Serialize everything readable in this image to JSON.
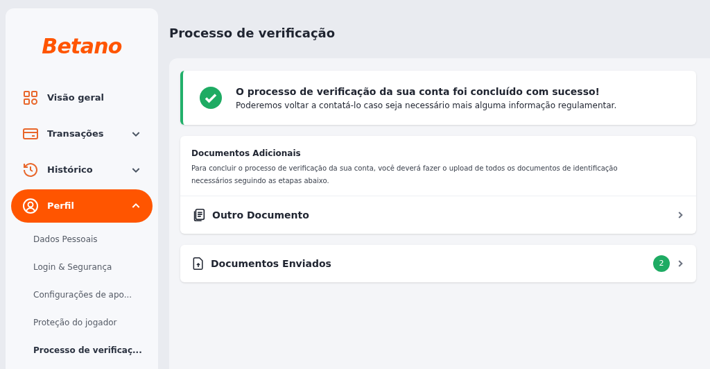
{
  "sidebar": {
    "logo": "Betano",
    "items": [
      {
        "label": "Visão geral",
        "kind": "grid",
        "selected": false
      },
      {
        "label": "Transações",
        "kind": "card",
        "selected": false,
        "expanded": false
      },
      {
        "label": "Histórico",
        "kind": "history",
        "selected": false,
        "expanded": false
      },
      {
        "label": "Perfil",
        "kind": "user",
        "selected": true,
        "expanded": true,
        "children": [
          {
            "label": "Dados Pessoais",
            "selected": false
          },
          {
            "label": "Login & Segurança",
            "selected": false
          },
          {
            "label": "Configurações de apo...",
            "selected": false
          },
          {
            "label": "Proteção do jogador",
            "selected": false
          },
          {
            "label": "Processo de verificaç...",
            "selected": true
          }
        ]
      }
    ]
  },
  "page": {
    "title": "Processo de verificação",
    "alert": {
      "title": "O processo de verificação da sua conta foi concluído com sucesso!",
      "text": "Poderemos voltar a contatá-lo caso seja necessário mais alguma informação regulamentar."
    },
    "additional": {
      "title": "Documentos Adicionais",
      "text": "Para concluir o processo de verificação da sua conta, você deverá fazer o upload de todos os documentos de identificação necessários seguindo as etapas abaixo.",
      "row": {
        "label": "Outro Documento"
      }
    },
    "sent": {
      "label": "Documentos Enviados",
      "count": "2"
    }
  }
}
